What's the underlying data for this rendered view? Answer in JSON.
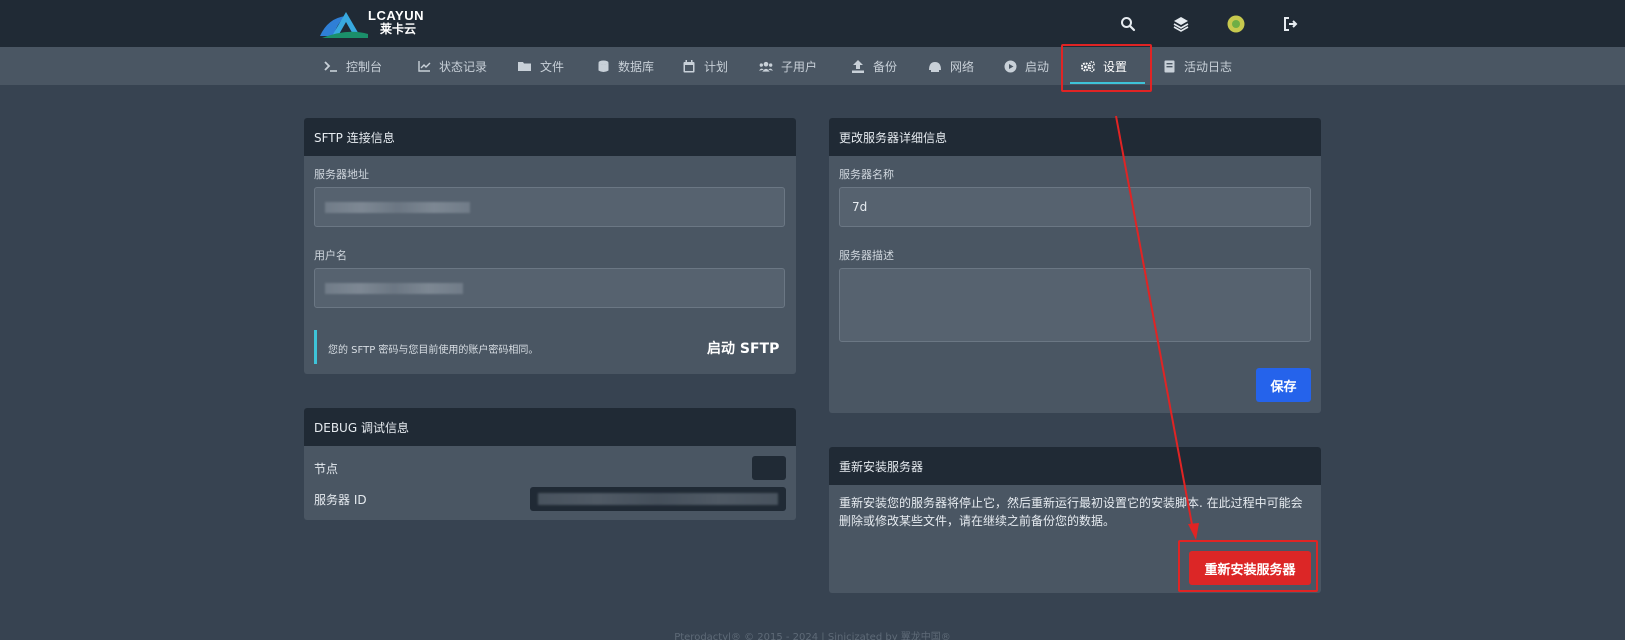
{
  "brand": {
    "logo_text": "LCAYUN",
    "logo_sub": "莱卡云"
  },
  "topbar": {
    "icons": [
      "search-icon",
      "layers-icon",
      "avatar",
      "logout-icon"
    ]
  },
  "nav": {
    "items": [
      {
        "label": "控制台",
        "icon": "terminal-icon"
      },
      {
        "label": "状态记录",
        "icon": "chart-icon"
      },
      {
        "label": "文件",
        "icon": "folder-icon"
      },
      {
        "label": "数据库",
        "icon": "database-icon"
      },
      {
        "label": "计划",
        "icon": "calendar-icon"
      },
      {
        "label": "子用户",
        "icon": "users-icon"
      },
      {
        "label": "备份",
        "icon": "upload-icon"
      },
      {
        "label": "网络",
        "icon": "network-icon"
      },
      {
        "label": "启动",
        "icon": "play-icon"
      },
      {
        "label": "设置",
        "icon": "gears-icon",
        "active": true
      },
      {
        "label": "活动日志",
        "icon": "book-icon"
      }
    ]
  },
  "sftp": {
    "title": "SFTP 连接信息",
    "address_label": "服务器地址",
    "username_label": "用户名",
    "note": "您的 SFTP 密码与您目前使用的账户密码相同。",
    "launch_label": "启动 SFTP"
  },
  "debug": {
    "title": "DEBUG 调试信息",
    "node_label": "节点",
    "server_id_label": "服务器 ID"
  },
  "details": {
    "title": "更改服务器详细信息",
    "name_label": "服务器名称",
    "name_value": "7d",
    "desc_label": "服务器描述",
    "save_label": "保存"
  },
  "reinstall": {
    "title": "重新安装服务器",
    "desc_line1": "重新安装您的服务器将停止它，然后重新运行最初设置它的安装脚本. 在此过程中可能会",
    "desc_line2": "删除或修改某些文件，请在继续之前备份您的数据。",
    "button_label": "重新安装服务器"
  },
  "footer": {
    "text": "Pterodactyl® © 2015 - 2024 | Sinicizated by 翼龙中国®"
  },
  "colors": {
    "accent_cyan": "#3ec3d8",
    "save_blue": "#2563eb",
    "danger_red": "#dc2626",
    "annotation_red": "#e02424"
  }
}
